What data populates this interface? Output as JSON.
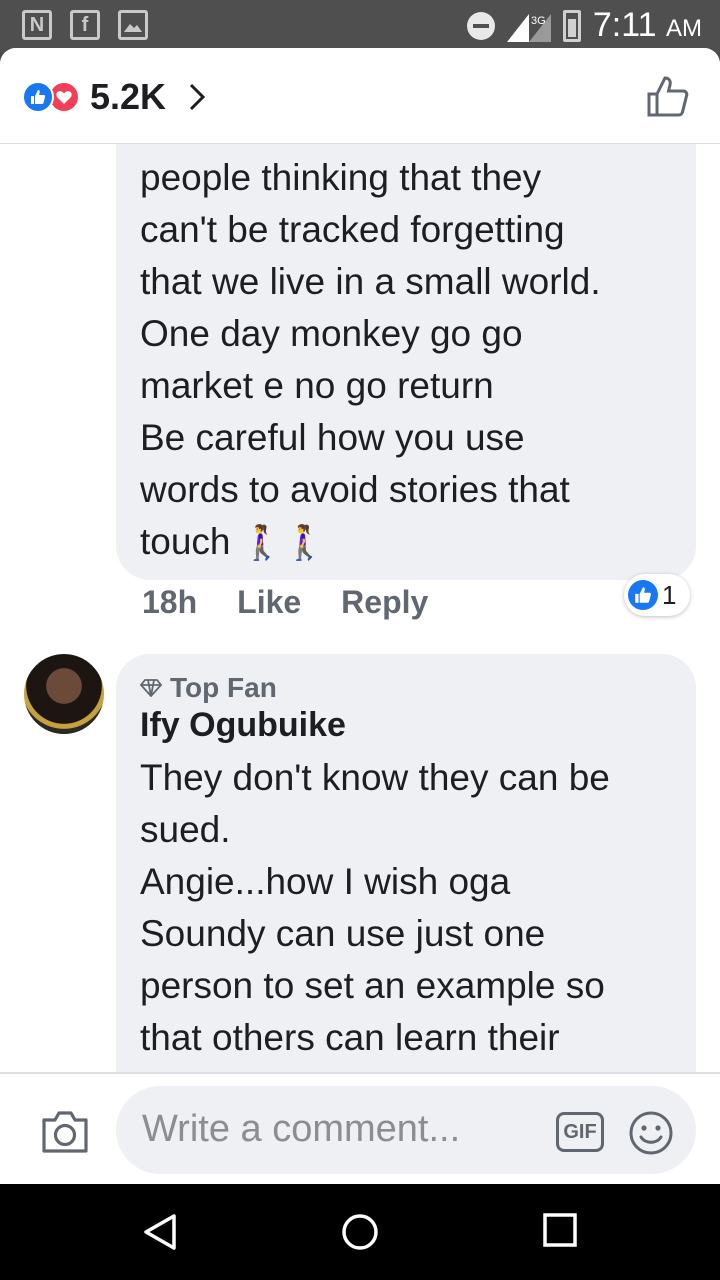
{
  "status_bar": {
    "left_icons": [
      "N",
      "f",
      "image"
    ],
    "network": "3G",
    "time": "7:11",
    "ampm": "AM"
  },
  "header": {
    "reaction_count": "5.2K",
    "reaction_icons": [
      "like-icon",
      "love-icon"
    ]
  },
  "comments": [
    {
      "text": "people thinking that they\ncan't be tracked forgetting\nthat we live in a small world.\nOne day monkey go go\nmarket e no go return\nBe careful how you use\nwords to avoid stories that\ntouch",
      "emoji": "🚶‍♀️🚶‍♀️",
      "time": "18h",
      "like_label": "Like",
      "reply_label": "Reply",
      "like_count": "1"
    },
    {
      "badge": "Top Fan",
      "author": "Ify Ogubuike",
      "text": "They don't know they can be\nsued.\nAngie...how I wish oga\nSoundy can use just one\nperson to set an example so\nthat others can learn their"
    }
  ],
  "composer": {
    "placeholder": "Write a comment...",
    "gif_label": "GIF"
  },
  "colors": {
    "accent": "#1877f2",
    "love": "#f33e58",
    "bubble": "#eff0f4"
  }
}
